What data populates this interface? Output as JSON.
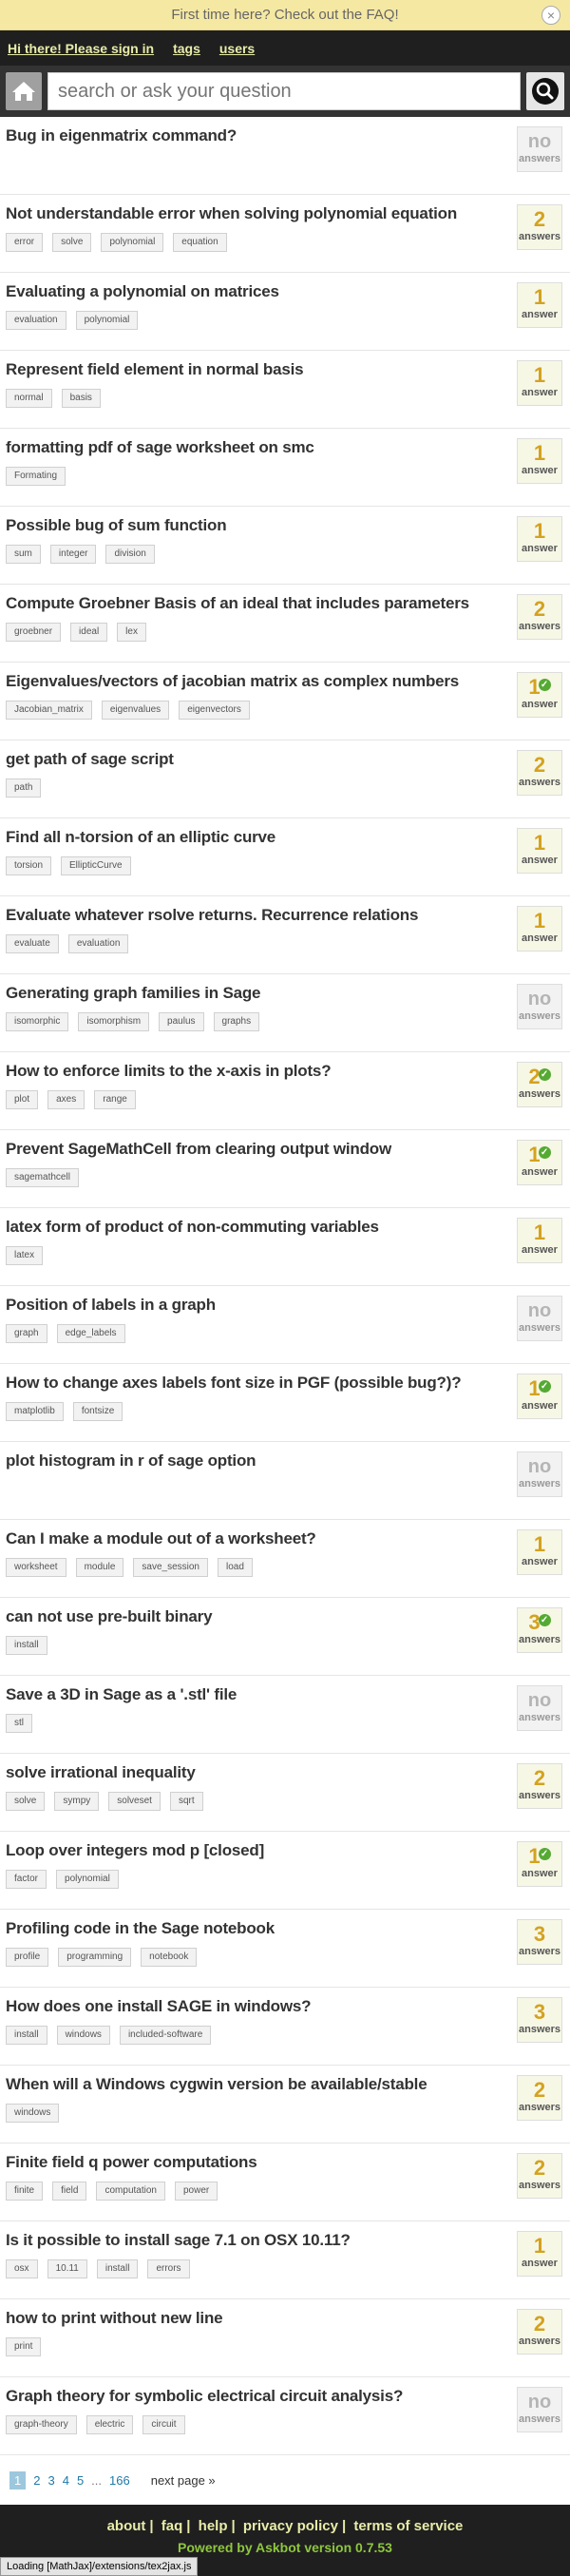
{
  "banner": {
    "text": "First time here? Check out the FAQ!",
    "close_glyph": "×"
  },
  "topbar": {
    "signin": "Hi there! Please sign in",
    "tags": "tags",
    "users": "users"
  },
  "search": {
    "placeholder": "search or ask your question"
  },
  "questions": [
    {
      "title": "Bug in eigenmatrix command?",
      "tags": [],
      "count": "no",
      "label": "answers",
      "accepted": false,
      "none": true
    },
    {
      "title": "Not understandable error when solving polynomial equation",
      "tags": [
        "error",
        "solve",
        "polynomial",
        "equation"
      ],
      "count": "2",
      "label": "answers",
      "accepted": false,
      "none": false
    },
    {
      "title": "Evaluating a polynomial on matrices",
      "tags": [
        "evaluation",
        "polynomial"
      ],
      "count": "1",
      "label": "answer",
      "accepted": false,
      "none": false
    },
    {
      "title": "Represent field element in normal basis",
      "tags": [
        "normal",
        "basis"
      ],
      "count": "1",
      "label": "answer",
      "accepted": false,
      "none": false
    },
    {
      "title": "formatting pdf of sage worksheet on smc",
      "tags": [
        "Formating"
      ],
      "count": "1",
      "label": "answer",
      "accepted": false,
      "none": false
    },
    {
      "title": "Possible bug of sum function",
      "tags": [
        "sum",
        "integer",
        "division"
      ],
      "count": "1",
      "label": "answer",
      "accepted": false,
      "none": false
    },
    {
      "title": "Compute Groebner Basis of an ideal that includes parameters",
      "tags": [
        "groebner",
        "ideal",
        "lex"
      ],
      "count": "2",
      "label": "answers",
      "accepted": false,
      "none": false
    },
    {
      "title": "Eigenvalues/vectors of jacobian matrix as complex numbers",
      "tags": [
        "Jacobian_matrix",
        "eigenvalues",
        "eigenvectors"
      ],
      "count": "1",
      "label": "answer",
      "accepted": true,
      "none": false
    },
    {
      "title": "get path of sage script",
      "tags": [
        "path"
      ],
      "count": "2",
      "label": "answers",
      "accepted": false,
      "none": false
    },
    {
      "title": "Find all n-torsion of an elliptic curve",
      "tags": [
        "torsion",
        "EllipticCurve"
      ],
      "count": "1",
      "label": "answer",
      "accepted": false,
      "none": false
    },
    {
      "title": "Evaluate whatever rsolve returns. Recurrence relations",
      "tags": [
        "evaluate",
        "evaluation"
      ],
      "count": "1",
      "label": "answer",
      "accepted": false,
      "none": false
    },
    {
      "title": "Generating graph families in Sage",
      "tags": [
        "isomorphic",
        "isomorphism",
        "paulus",
        "graphs"
      ],
      "count": "no",
      "label": "answers",
      "accepted": false,
      "none": true
    },
    {
      "title": "How to enforce limits to the x-axis in plots?",
      "tags": [
        "plot",
        "axes",
        "range"
      ],
      "count": "2",
      "label": "answers",
      "accepted": true,
      "none": false
    },
    {
      "title": "Prevent SageMathCell from clearing output window",
      "tags": [
        "sagemathcell"
      ],
      "count": "1",
      "label": "answer",
      "accepted": true,
      "none": false
    },
    {
      "title": "latex form of product of non-commuting variables",
      "tags": [
        "latex"
      ],
      "count": "1",
      "label": "answer",
      "accepted": false,
      "none": false
    },
    {
      "title": "Position of labels in a graph",
      "tags": [
        "graph",
        "edge_labels"
      ],
      "count": "no",
      "label": "answers",
      "accepted": false,
      "none": true
    },
    {
      "title": "How to change axes labels font size in PGF (possible bug?)?",
      "tags": [
        "matplotlib",
        "fontsize"
      ],
      "count": "1",
      "label": "answer",
      "accepted": true,
      "none": false
    },
    {
      "title": "plot histogram in r of sage option",
      "tags": [],
      "count": "no",
      "label": "answers",
      "accepted": false,
      "none": true
    },
    {
      "title": "Can I make a module out of a worksheet?",
      "tags": [
        "worksheet",
        "module",
        "save_session",
        "load"
      ],
      "count": "1",
      "label": "answer",
      "accepted": false,
      "none": false
    },
    {
      "title": "can not use pre-built binary",
      "tags": [
        "install"
      ],
      "count": "3",
      "label": "answers",
      "accepted": true,
      "none": false
    },
    {
      "title": "Save a 3D in Sage as a '.stl' file",
      "tags": [
        "stl"
      ],
      "count": "no",
      "label": "answers",
      "accepted": false,
      "none": true
    },
    {
      "title": "solve irrational inequality",
      "tags": [
        "solve",
        "sympy",
        "solveset",
        "sqrt"
      ],
      "count": "2",
      "label": "answers",
      "accepted": false,
      "none": false
    },
    {
      "title": "Loop over integers mod p [closed]",
      "tags": [
        "factor",
        "polynomial"
      ],
      "count": "1",
      "label": "answer",
      "accepted": true,
      "none": false
    },
    {
      "title": "Profiling code in the Sage notebook",
      "tags": [
        "profile",
        "programming",
        "notebook"
      ],
      "count": "3",
      "label": "answers",
      "accepted": false,
      "none": false
    },
    {
      "title": "How does one install SAGE in windows?",
      "tags": [
        "install",
        "windows",
        "included-software"
      ],
      "count": "3",
      "label": "answers",
      "accepted": false,
      "none": false
    },
    {
      "title": "When will a Windows cygwin version be available/stable",
      "tags": [
        "windows"
      ],
      "count": "2",
      "label": "answers",
      "accepted": false,
      "none": false
    },
    {
      "title": "Finite field q power computations",
      "tags": [
        "finite",
        "field",
        "computation",
        "power"
      ],
      "count": "2",
      "label": "answers",
      "accepted": false,
      "none": false
    },
    {
      "title": "Is it possible to install sage 7.1 on OSX 10.11?",
      "tags": [
        "osx",
        "10.11",
        "install",
        "errors"
      ],
      "count": "1",
      "label": "answer",
      "accepted": false,
      "none": false
    },
    {
      "title": "how to print without new line",
      "tags": [
        "print"
      ],
      "count": "2",
      "label": "answers",
      "accepted": false,
      "none": false
    },
    {
      "title": "Graph theory for symbolic electrical circuit analysis?",
      "tags": [
        "graph-theory",
        "electric",
        "circuit"
      ],
      "count": "no",
      "label": "answers",
      "accepted": false,
      "none": true
    }
  ],
  "pager": {
    "current": "1",
    "pages": [
      "2",
      "3",
      "4",
      "5"
    ],
    "dots": "...",
    "last": "166",
    "next": "next page »"
  },
  "footer": {
    "links": [
      "about",
      "faq",
      "help",
      "privacy policy",
      "terms of service"
    ],
    "powered": "Powered by Askbot version 0.7.53",
    "loading": "Loading [MathJax]/extensions/tex2jax.js"
  },
  "colors": {
    "accent": "#d4a21f",
    "accepted": "#55aa33",
    "link": "#e8eca8",
    "banner": "#f5e8a3"
  },
  "icons": {
    "home": "home-icon",
    "search": "search-icon",
    "check": "check-icon"
  }
}
